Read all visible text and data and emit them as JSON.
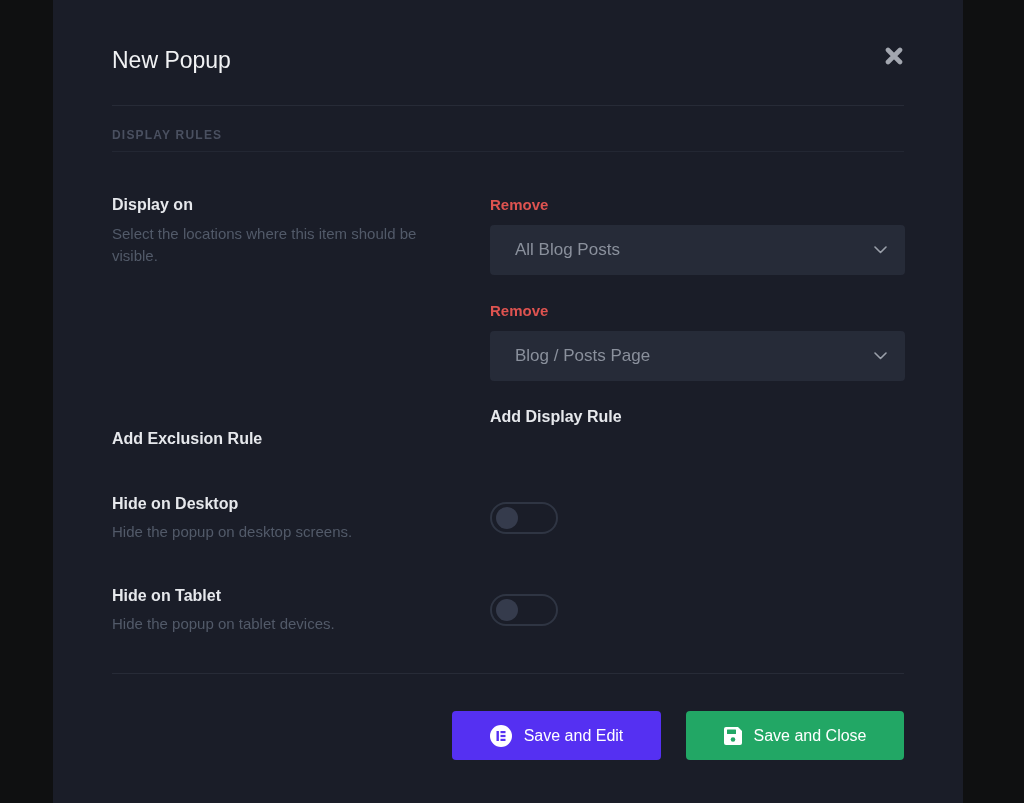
{
  "dialog": {
    "title": "New Popup",
    "section_heading": "DISPLAY RULES",
    "display_on": {
      "label": "Display on",
      "description": "Select the locations where this item should be visible.",
      "rules": [
        {
          "remove_link": "Remove",
          "value": "All Blog Posts"
        },
        {
          "remove_link": "Remove",
          "value": "Blog / Posts Page"
        }
      ],
      "add_rule": "Add Display Rule"
    },
    "exclusion": {
      "add_rule": "Add Exclusion Rule"
    },
    "toggles": [
      {
        "label": "Hide on Desktop",
        "description": "Hide the popup on desktop screens.",
        "on": false
      },
      {
        "label": "Hide on Tablet",
        "description": "Hide the popup on tablet devices.",
        "on": false
      }
    ],
    "buttons": [
      {
        "kind": "edit",
        "label": "Save and Edit"
      },
      {
        "kind": "save",
        "label": "Save and Close"
      }
    ]
  }
}
